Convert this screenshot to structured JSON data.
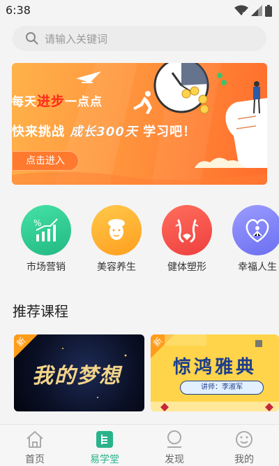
{
  "status_bar": {
    "time": "6:38"
  },
  "search": {
    "placeholder": "请输入关键词"
  },
  "banner": {
    "line1_prefix": "每天",
    "line1_highlight": "进步",
    "line1_suffix": "一点点",
    "line2_prefix": "快来挑战 ",
    "line2_highlight": "成长300天",
    "line2_suffix": " 学习吧！",
    "button_label": "点击进入"
  },
  "categories": [
    {
      "label": "市场营销",
      "icon": "growth-chart-icon",
      "color": "#2fcf96"
    },
    {
      "label": "美容养生",
      "icon": "face-mask-icon",
      "color": "#ffb52e"
    },
    {
      "label": "健体塑形",
      "icon": "body-shape-icon",
      "color": "#f5584e"
    },
    {
      "label": "幸福人生",
      "icon": "heart-person-icon",
      "color": "#7a7cf5"
    }
  ],
  "recommend": {
    "title": "推荐课程",
    "courses": [
      {
        "tag": "新",
        "title": "我的梦想"
      },
      {
        "tag": "新",
        "title": "惊鸿雅典",
        "subtitle": "讲师：李淑军"
      }
    ]
  },
  "bottom_nav": [
    {
      "label": "首页",
      "icon": "home-icon",
      "active": false
    },
    {
      "label": "易学堂",
      "icon": "book-icon",
      "active": true
    },
    {
      "label": "发现",
      "icon": "discover-icon",
      "active": false
    },
    {
      "label": "我的",
      "icon": "smile-face-icon",
      "active": false
    }
  ],
  "colors": {
    "accent": "#2ab38b",
    "banner_orange": "#ff8d3a"
  }
}
